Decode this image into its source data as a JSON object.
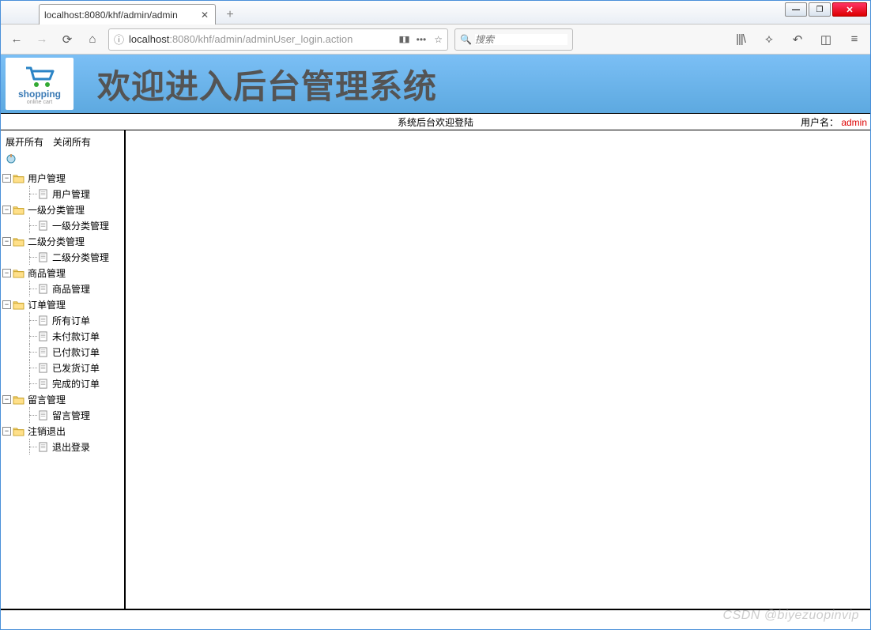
{
  "window": {
    "tab_title": "localhost:8080/khf/admin/admin"
  },
  "toolbar": {
    "url_host": "localhost",
    "url_port_path": ":8080/khf/admin/adminUser_login.action",
    "search_placeholder": "搜索"
  },
  "banner": {
    "logo_text": "shopping",
    "logo_sub": "online cart",
    "title": "欢迎进入后台管理系统"
  },
  "statusbar": {
    "center": "系统后台欢迎登陆",
    "user_label": "用户名：",
    "user_name": "admin"
  },
  "sidebar": {
    "expand_all": "展开所有",
    "collapse_all": "关闭所有",
    "tree": [
      {
        "label": "用户管理",
        "children": [
          {
            "label": "用户管理"
          }
        ]
      },
      {
        "label": "一级分类管理",
        "children": [
          {
            "label": "一级分类管理"
          }
        ]
      },
      {
        "label": "二级分类管理",
        "children": [
          {
            "label": "二级分类管理"
          }
        ]
      },
      {
        "label": "商品管理",
        "children": [
          {
            "label": "商品管理"
          }
        ]
      },
      {
        "label": "订单管理",
        "children": [
          {
            "label": "所有订单"
          },
          {
            "label": "未付款订单"
          },
          {
            "label": "已付款订单"
          },
          {
            "label": "已发货订单"
          },
          {
            "label": "完成的订单"
          }
        ]
      },
      {
        "label": "留言管理",
        "children": [
          {
            "label": "留言管理"
          }
        ]
      },
      {
        "label": "注销退出",
        "children": [
          {
            "label": "退出登录"
          }
        ]
      }
    ]
  },
  "watermark": "CSDN @biyezuopinvip"
}
